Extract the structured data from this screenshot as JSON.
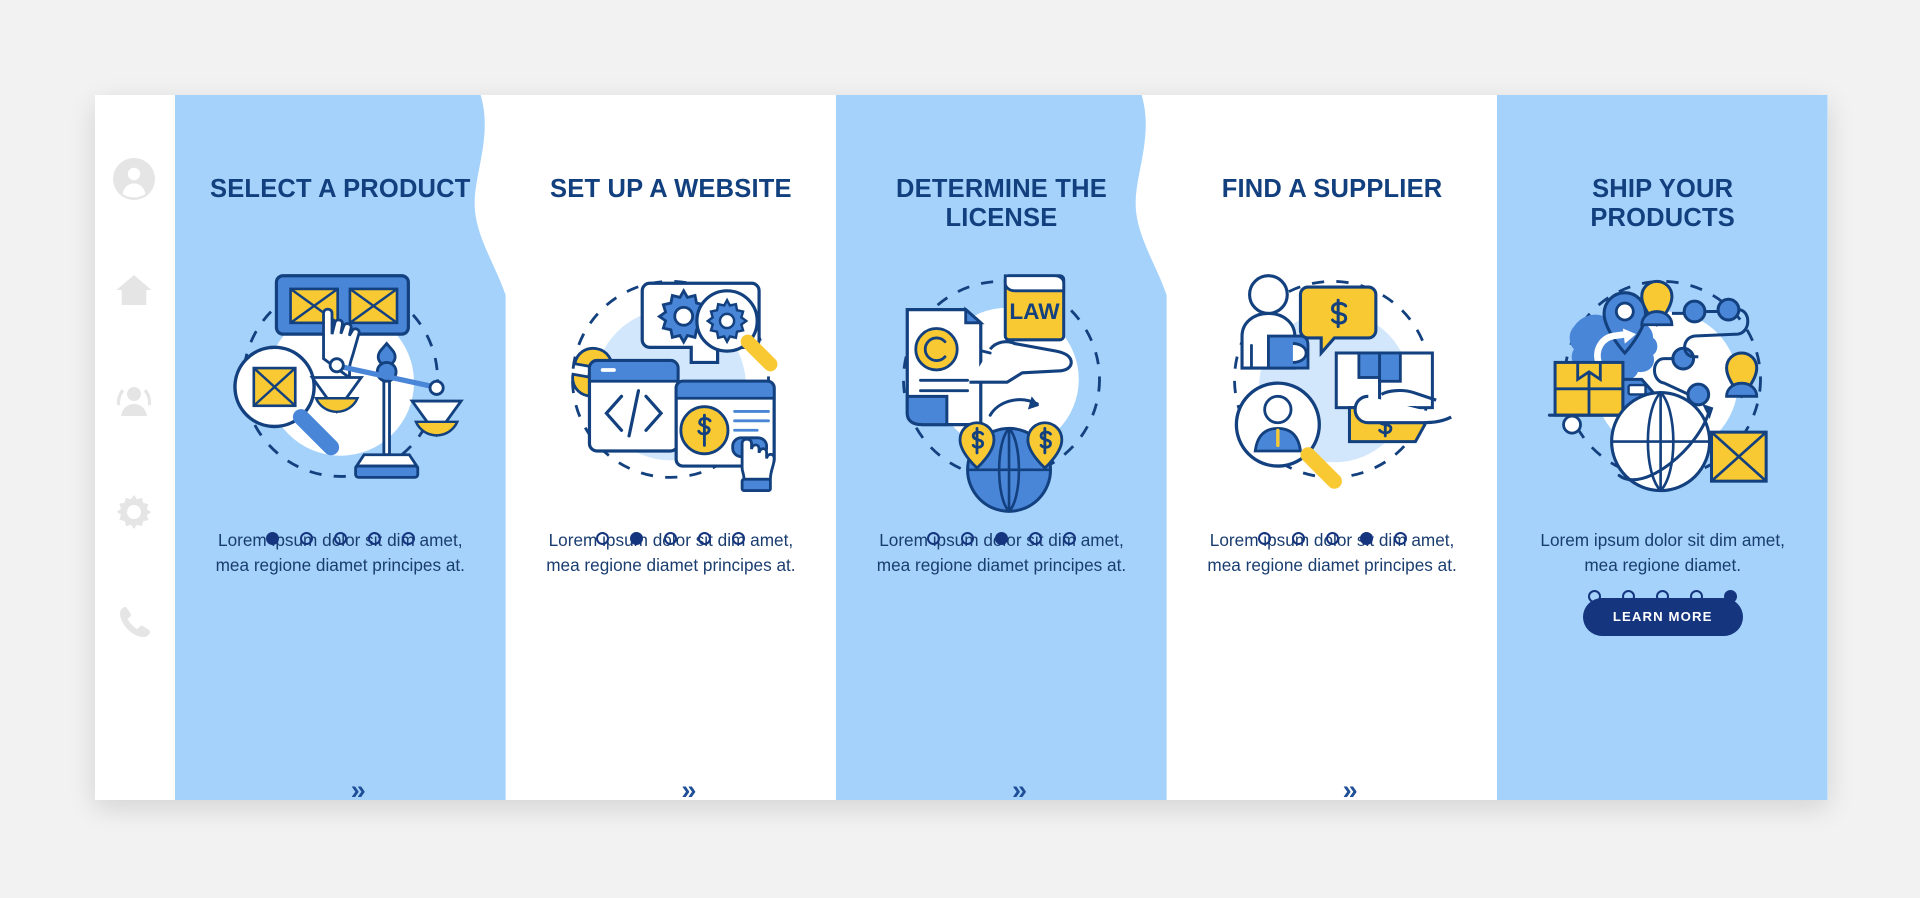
{
  "app": {
    "background_color": "#f2f2f2",
    "card_background": "#ffffff",
    "accent_blue": "#a5d2fb",
    "title_color": "#123f7e",
    "yellow": "#f9c933",
    "mid_blue": "#4a86d8",
    "navy": "#15357f"
  },
  "sidebar": {
    "items": [
      {
        "icon": "user-avatar-icon",
        "label": "Profile"
      },
      {
        "icon": "home-icon",
        "label": "Home"
      },
      {
        "icon": "people-group-icon",
        "label": "Team"
      },
      {
        "icon": "gear-icon",
        "label": "Settings"
      },
      {
        "icon": "phone-icon",
        "label": "Contact"
      }
    ]
  },
  "separators": {
    "arrow_glyph": "»"
  },
  "panels": [
    {
      "title": "SELECT A PRODUCT",
      "body": "Lorem ipsum dolor sit dim amet, mea regione diamet principes at.",
      "theme": "blue",
      "illustration": "product-selection-scales-illustration",
      "dots_total": 5,
      "dots_active": 1,
      "has_button": false,
      "button_label": ""
    },
    {
      "title": "SET UP A WEBSITE",
      "body": "Lorem ipsum dolor sit dim amet, mea regione diamet principes at.",
      "theme": "white",
      "illustration": "website-setup-code-gears-illustration",
      "dots_total": 5,
      "dots_active": 2,
      "has_button": false,
      "button_label": ""
    },
    {
      "title": "DETERMINE THE LICENSE",
      "body": "Lorem ipsum dolor sit dim amet, mea regione diamet principes at.",
      "theme": "blue",
      "illustration": "law-license-globe-illustration",
      "dots_total": 5,
      "dots_active": 3,
      "has_button": false,
      "button_label": ""
    },
    {
      "title": "FIND A SUPPLIER",
      "body": "Lorem ipsum dolor sit dim amet, mea regione diamet principes at.",
      "theme": "white",
      "illustration": "supplier-search-package-illustration",
      "dots_total": 5,
      "dots_active": 4,
      "has_button": false,
      "button_label": ""
    },
    {
      "title": "SHIP YOUR PRODUCTS",
      "body": "Lorem ipsum dolor sit dim amet, mea regione diamet.",
      "theme": "blue",
      "illustration": "shipping-truck-globe-illustration",
      "dots_total": 5,
      "dots_active": 5,
      "has_button": true,
      "button_label": "LEARN MORE"
    }
  ],
  "illustration_labels": {
    "law_book": "LAW"
  }
}
